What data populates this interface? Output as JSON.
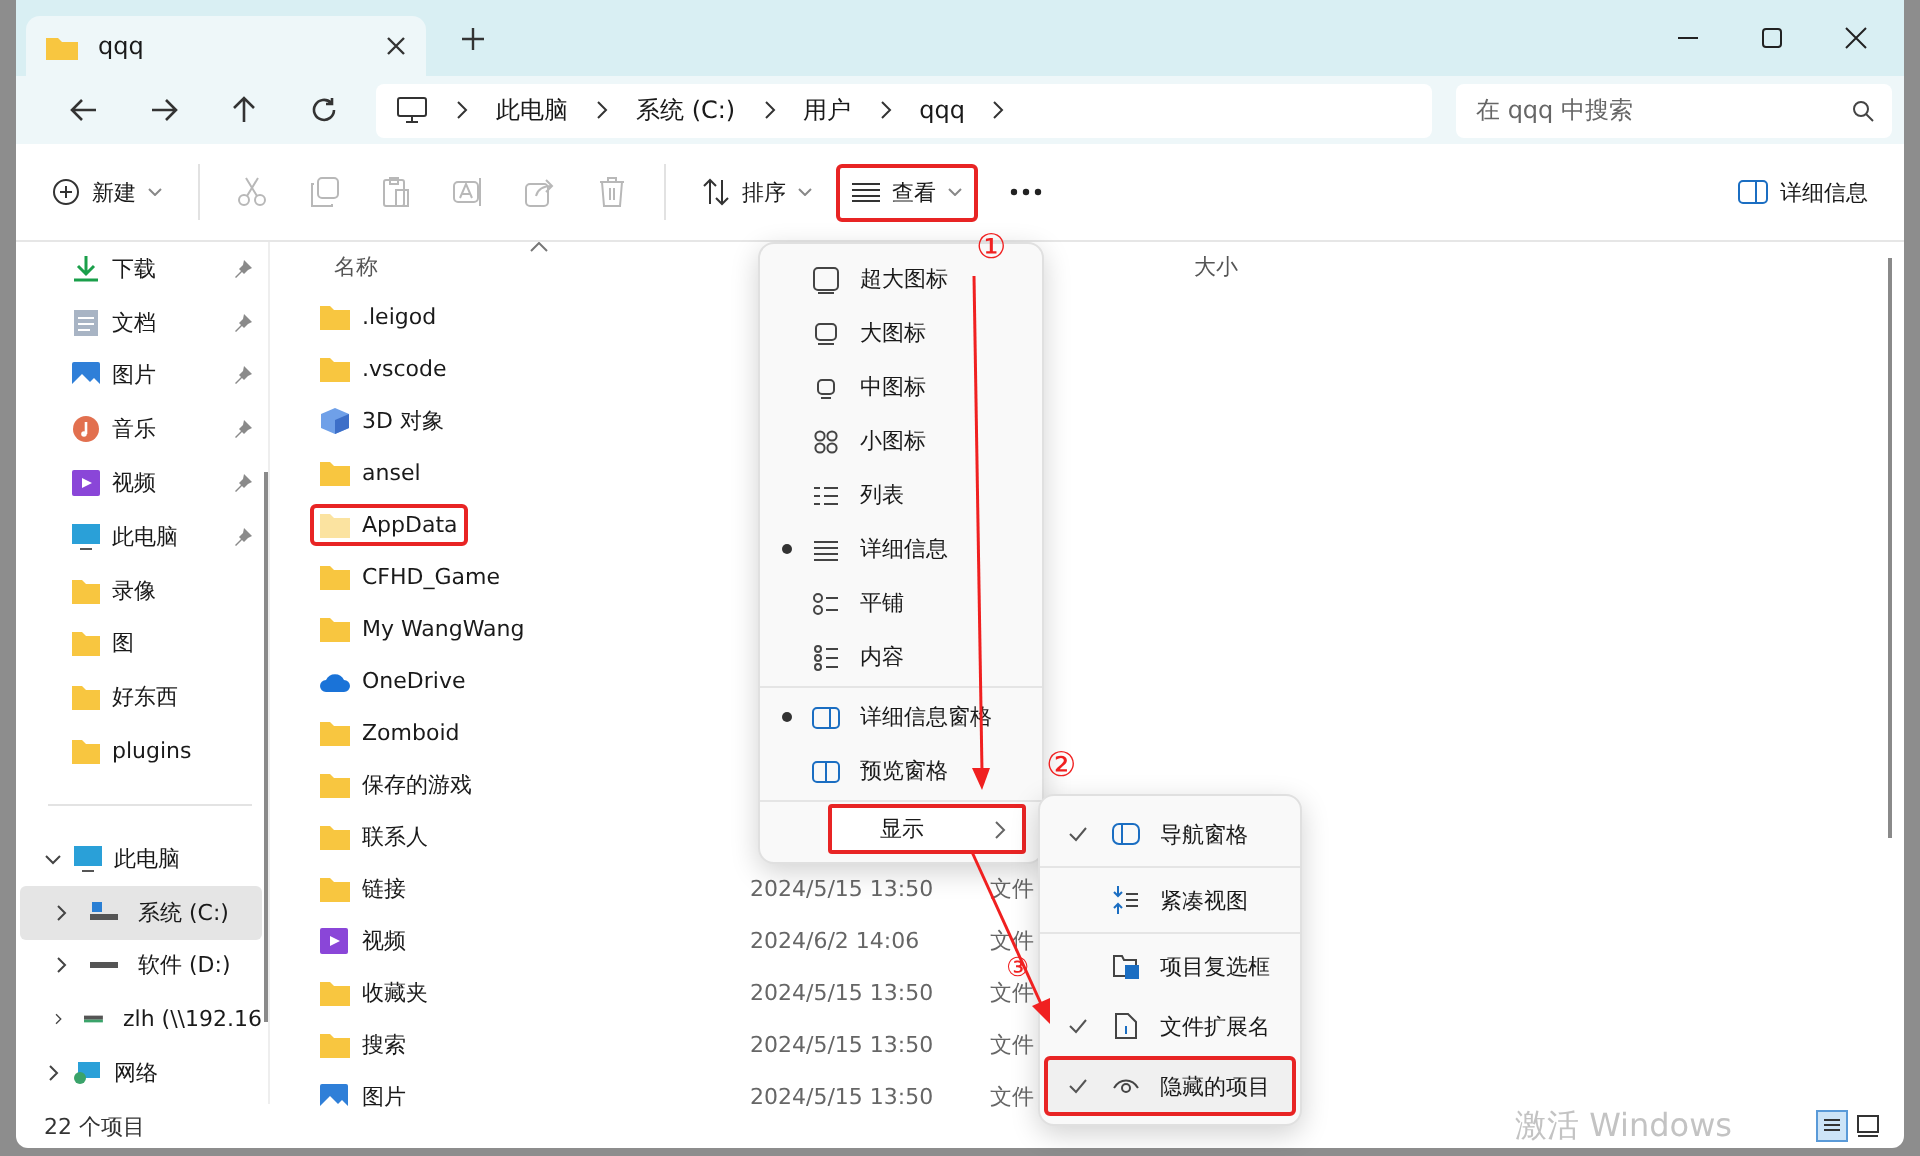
{
  "window": {
    "tab": {
      "title": "qqq"
    }
  },
  "address": {
    "crumbs": [
      "此电脑",
      "系统 (C:)",
      "用户",
      "qqq"
    ],
    "search": {
      "placeholder": "在 qqq 中搜索"
    }
  },
  "toolbar": {
    "new": {
      "label": "新建"
    },
    "actions": [
      {
        "kind": "cut",
        "disabled": true
      },
      {
        "kind": "copy",
        "disabled": true
      },
      {
        "kind": "paste",
        "disabled": true
      },
      {
        "kind": "rename",
        "disabled": true
      },
      {
        "kind": "share",
        "disabled": true
      },
      {
        "kind": "delete",
        "disabled": true
      }
    ],
    "sort": {
      "label": "排序"
    },
    "view": {
      "label": "查看",
      "highlighted": true
    },
    "details": {
      "label": "详细信息"
    }
  },
  "sidebar": {
    "quick": [
      {
        "label": "下载",
        "kind": "download",
        "pinned": true
      },
      {
        "label": "文档",
        "kind": "document",
        "pinned": true
      },
      {
        "label": "图片",
        "kind": "picture",
        "pinned": true
      },
      {
        "label": "音乐",
        "kind": "music",
        "pinned": true
      },
      {
        "label": "视频",
        "kind": "video",
        "pinned": true
      },
      {
        "label": "此电脑",
        "kind": "pc",
        "pinned": true
      },
      {
        "label": "录像",
        "kind": "folder",
        "pinned": false
      },
      {
        "label": "图",
        "kind": "folder",
        "pinned": false
      },
      {
        "label": "好东西",
        "kind": "folder",
        "pinned": false
      },
      {
        "label": "plugins",
        "kind": "folder",
        "pinned": false
      }
    ],
    "tree": [
      {
        "label": "此电脑",
        "kind": "pc",
        "expanded": true,
        "selected": false,
        "children": [
          {
            "label": "系统 (C:)",
            "kind": "systemdrive",
            "expanded": false,
            "selected": true
          },
          {
            "label": "软件 (D:)",
            "kind": "drive",
            "expanded": false,
            "selected": false
          },
          {
            "label": "zlh (\\\\192.16",
            "kind": "netdrive",
            "expanded": false,
            "selected": false
          }
        ]
      },
      {
        "label": "网络",
        "kind": "network",
        "expanded": false,
        "selected": false
      }
    ]
  },
  "table": {
    "columns": [
      {
        "label": "名称"
      },
      {
        "label": "大小"
      }
    ],
    "rows": [
      {
        "name": ".leigod",
        "kind": "folder",
        "highlighted": false
      },
      {
        "name": ".vscode",
        "kind": "folder",
        "highlighted": false
      },
      {
        "name": "3D 对象",
        "kind": "cube",
        "highlighted": false
      },
      {
        "name": "ansel",
        "kind": "folder",
        "highlighted": false
      },
      {
        "name": "AppData",
        "kind": "folder",
        "highlighted": true
      },
      {
        "name": "CFHD_Game",
        "kind": "folder",
        "highlighted": false
      },
      {
        "name": "My WangWang",
        "kind": "folder",
        "highlighted": false
      },
      {
        "name": "OneDrive",
        "kind": "cloud",
        "highlighted": false
      },
      {
        "name": "Zomboid",
        "kind": "folder",
        "highlighted": false
      },
      {
        "name": "保存的游戏",
        "kind": "folder",
        "highlighted": false
      },
      {
        "name": "联系人",
        "kind": "folder",
        "highlighted": false
      },
      {
        "name": "链接",
        "kind": "folder",
        "highlighted": false,
        "date": "2024/5/15 13:50",
        "type": "文件"
      },
      {
        "name": "视频",
        "kind": "video",
        "highlighted": false,
        "date": "2024/6/2 14:06",
        "type": "文件"
      },
      {
        "name": "收藏夹",
        "kind": "folder",
        "highlighted": false,
        "date": "2024/5/15 13:50",
        "type": "文件"
      },
      {
        "name": "搜索",
        "kind": "folder",
        "highlighted": false,
        "date": "2024/5/15 13:50",
        "type": "文件"
      },
      {
        "name": "图片",
        "kind": "picture",
        "highlighted": false,
        "date": "2024/5/15 13:50",
        "type": "文件"
      }
    ]
  },
  "view_menu": {
    "groups": [
      [
        {
          "label": "超大图标",
          "kind": "xl",
          "selected": false
        },
        {
          "label": "大图标",
          "kind": "lg",
          "selected": false
        },
        {
          "label": "中图标",
          "kind": "md",
          "selected": false
        },
        {
          "label": "小图标",
          "kind": "sm",
          "selected": false
        },
        {
          "label": "列表",
          "kind": "list",
          "selected": false
        },
        {
          "label": "详细信息",
          "kind": "details",
          "selected": true
        },
        {
          "label": "平铺",
          "kind": "tiles",
          "selected": false
        },
        {
          "label": "内容",
          "kind": "content",
          "selected": false
        }
      ],
      [
        {
          "label": "详细信息窗格",
          "kind": "detailspane",
          "selected": true
        },
        {
          "label": "预览窗格",
          "kind": "previewpane",
          "selected": false
        }
      ]
    ],
    "show": {
      "label": "显示",
      "highlighted": true
    }
  },
  "show_menu": {
    "groups": [
      [
        {
          "label": "导航窗格",
          "kind": "navpane",
          "checked": true,
          "highlighted": false
        }
      ],
      [
        {
          "label": "紧凑视图",
          "kind": "compact",
          "checked": false,
          "highlighted": false
        }
      ],
      [
        {
          "label": "项目复选框",
          "kind": "checkbox",
          "checked": false,
          "highlighted": false
        },
        {
          "label": "文件扩展名",
          "kind": "extension",
          "checked": true,
          "highlighted": false
        },
        {
          "label": "隐藏的项目",
          "kind": "eye",
          "checked": true,
          "highlighted": true
        }
      ]
    ]
  },
  "annotations": [
    {
      "label": "①"
    },
    {
      "label": "②"
    },
    {
      "label": "③"
    }
  ],
  "status_bar": {
    "count": "22 个项目"
  },
  "activation_notice": "激活 Windows"
}
